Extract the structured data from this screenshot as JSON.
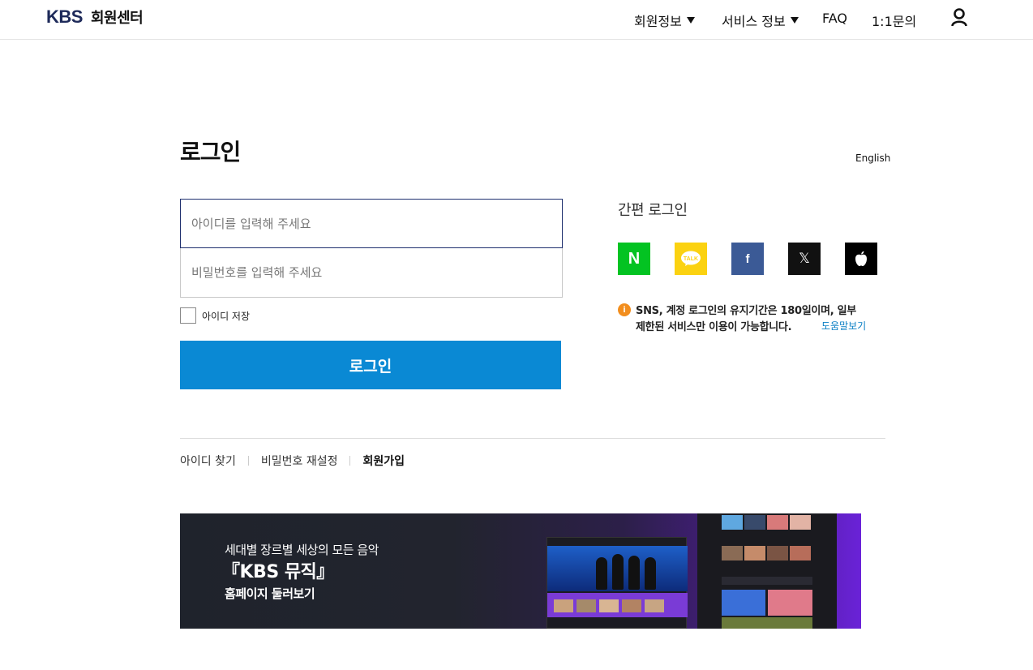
{
  "header": {
    "logo_brand": "KBS",
    "logo_title": "회원센터",
    "nav": {
      "member_info": "회원정보",
      "service_info": "서비스 정보",
      "faq": "FAQ",
      "inquiry": "1:1문의"
    }
  },
  "login": {
    "title": "로그인",
    "language_link": "English",
    "id_placeholder": "아이디를 입력해 주세요",
    "pw_placeholder": "비밀번호를 입력해 주세요",
    "save_id_label": "아이디 저장",
    "submit_label": "로그인"
  },
  "sns": {
    "title": "간편 로그인",
    "providers": [
      "naver",
      "kakao",
      "facebook",
      "x",
      "apple"
    ],
    "naver_glyph": "N",
    "facebook_glyph": "f",
    "x_glyph": "𝕏",
    "notice_line1": "SNS, 계정 로그인의 유지기간은 180일이며, 일부",
    "notice_line2": "제한된 서비스만 이용이 가능합니다.",
    "help_link": "도움말보기",
    "colors": {
      "naver": "#03c322",
      "kakao": "#fbd211",
      "facebook": "#3b5a96",
      "x": "#111111",
      "apple": "#000000"
    }
  },
  "links": {
    "find_id": "아이디 찾기",
    "reset_pw": "비밀번호 재설정",
    "signup": "회원가입"
  },
  "banner": {
    "line1": "세대별 장르별 세상의 모든 음악",
    "line2": "『KBS 뮤직』",
    "line3": "홈페이지 둘러보기"
  },
  "colors": {
    "primary": "#0a89d4",
    "brand": "#1e2a5a",
    "notice": "#f28e1e"
  }
}
